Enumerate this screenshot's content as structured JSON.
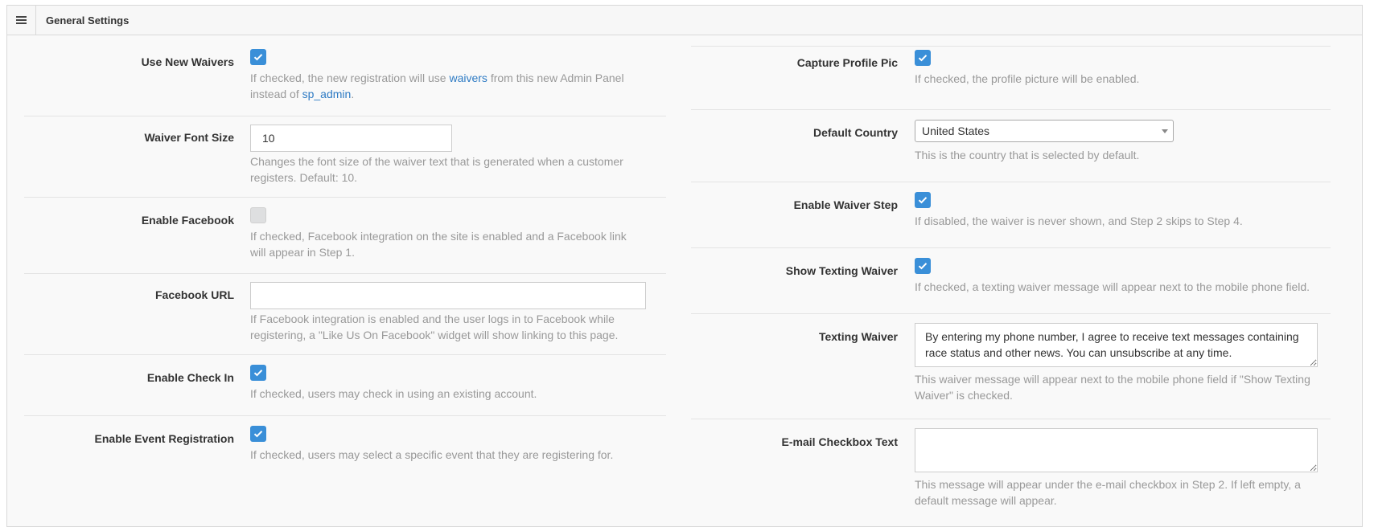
{
  "header": {
    "title": "General Settings",
    "menu_icon": "hamburger-icon"
  },
  "left": {
    "use_new_waivers": {
      "label": "Use New Waivers",
      "checked": true,
      "help_prefix": "If checked, the new registration will use ",
      "help_link1": "waivers",
      "help_middle": " from this new Admin Panel instead of ",
      "help_link2": "sp_admin",
      "help_suffix": "."
    },
    "waiver_font_size": {
      "label": "Waiver Font Size",
      "value": "10",
      "help": "Changes the font size of the waiver text that is generated when a customer registers. Default: 10."
    },
    "enable_facebook": {
      "label": "Enable Facebook",
      "checked": false,
      "help": "If checked, Facebook integration on the site is enabled and a Facebook link will appear in Step 1."
    },
    "facebook_url": {
      "label": "Facebook URL",
      "value": "",
      "help": "If Facebook integration is enabled and the user logs in to Facebook while registering, a \"Like Us On Facebook\" widget will show linking to this page."
    },
    "enable_check_in": {
      "label": "Enable Check In",
      "checked": true,
      "help": "If checked, users may check in using an existing account."
    },
    "enable_event_registration": {
      "label": "Enable Event Registration",
      "checked": true,
      "help": "If checked, users may select a specific event that they are registering for."
    }
  },
  "right": {
    "capture_profile_pic": {
      "label": "Capture Profile Pic",
      "checked": true,
      "help": "If checked, the profile picture will be enabled."
    },
    "default_country": {
      "label": "Default Country",
      "value": "United States",
      "help": "This is the country that is selected by default."
    },
    "enable_waiver_step": {
      "label": "Enable Waiver Step",
      "checked": true,
      "help": "If disabled, the waiver is never shown, and Step 2 skips to Step 4."
    },
    "show_texting_waiver": {
      "label": "Show Texting Waiver",
      "checked": true,
      "help": "If checked, a texting waiver message will appear next to the mobile phone field."
    },
    "texting_waiver": {
      "label": "Texting Waiver",
      "value": "By entering my phone number, I agree to receive text messages containing race status and other news. You can unsubscribe at any time.",
      "help": "This waiver message will appear next to the mobile phone field if \"Show Texting Waiver\" is checked."
    },
    "email_checkbox_text": {
      "label": "E-mail Checkbox Text",
      "value": "",
      "help": "This message will appear under the e-mail checkbox in Step 2. If left empty, a default message will appear."
    }
  },
  "colors": {
    "accent": "#3a8fd8",
    "link": "#2e7bc4",
    "help_text": "#999999"
  }
}
